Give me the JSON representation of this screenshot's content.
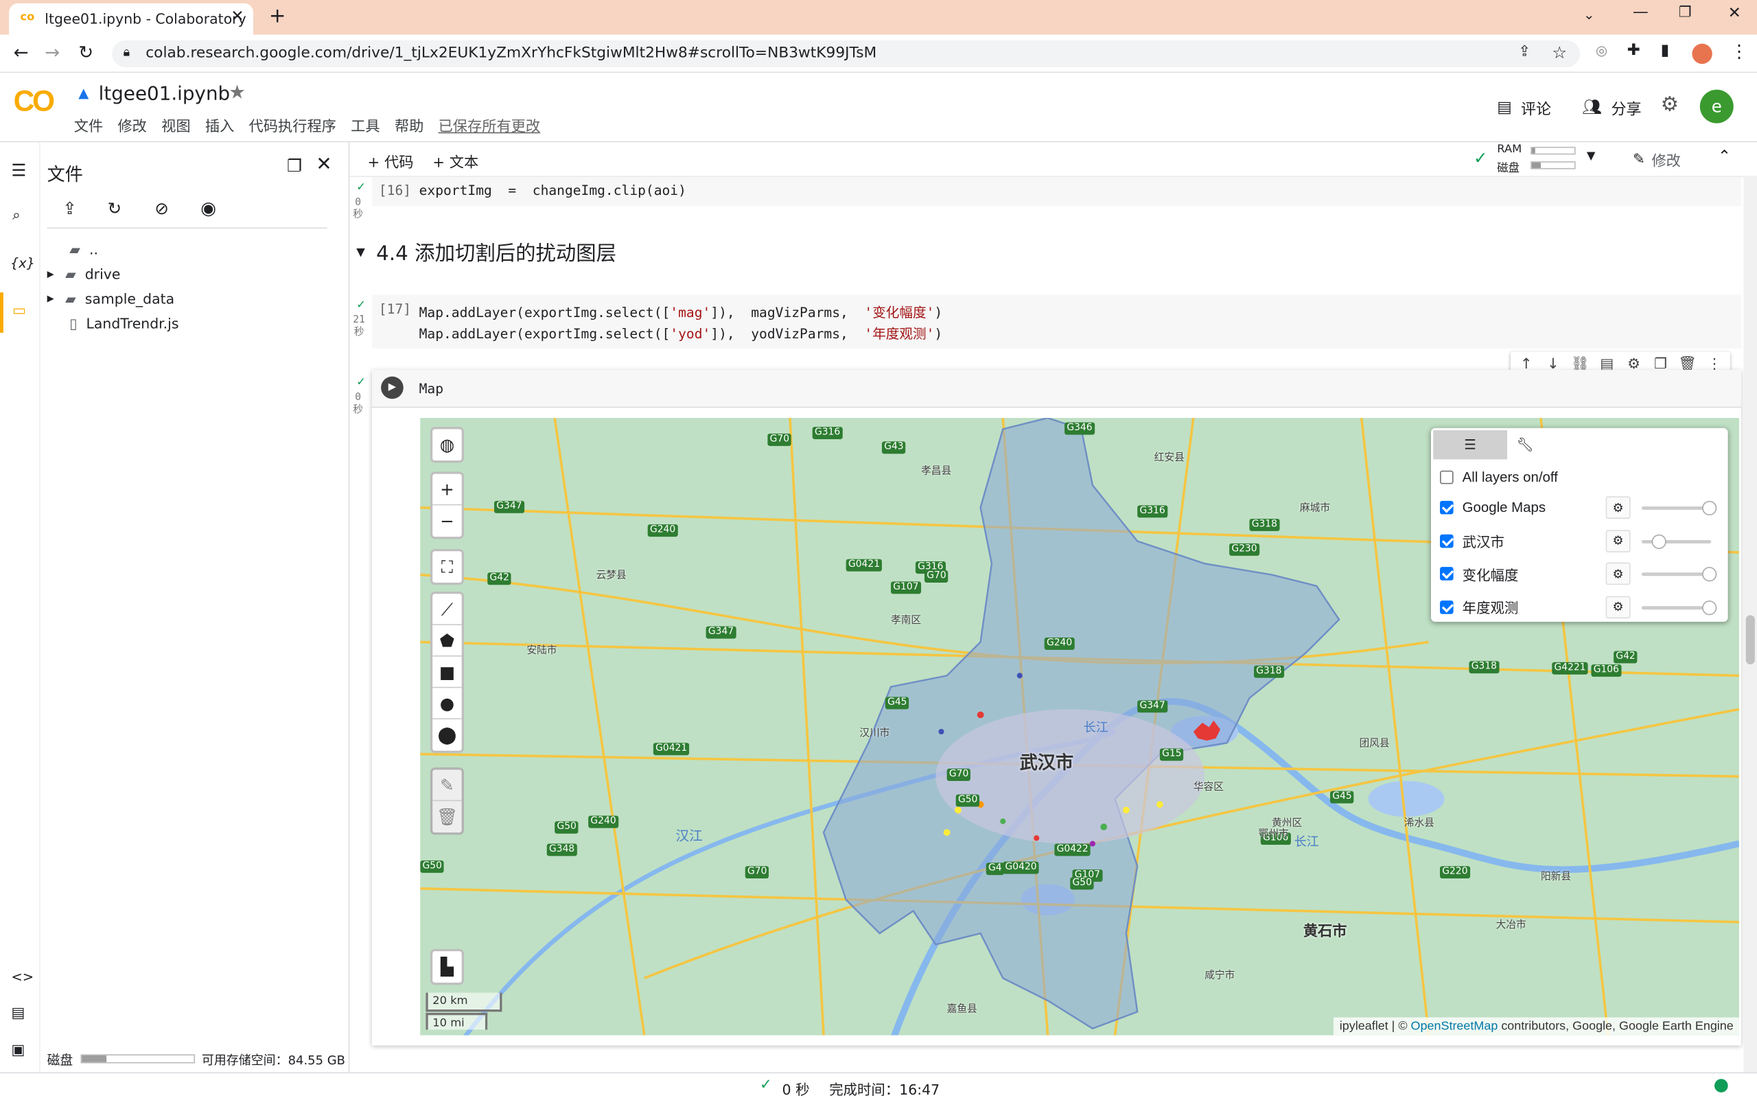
{
  "browser": {
    "tab_title": "ltgee01.ipynb - Colaboratory",
    "url": "colab.research.google.com/drive/1_tjLx2EUK1yZmXrYhcFkStgiwMlt2Hw8#scrollTo=NB3wtK99JTsM"
  },
  "colab": {
    "logo": "CO",
    "notebook_title": "ltgee01.ipynb",
    "menu": [
      "文件",
      "修改",
      "视图",
      "插入",
      "代码执行程序",
      "工具",
      "帮助"
    ],
    "saved_status": "已保存所有更改",
    "comment_label": "评论",
    "share_label": "分享",
    "avatar_letter": "e"
  },
  "sidebar": {
    "title": "文件",
    "tree": [
      {
        "name": "..",
        "type": "up"
      },
      {
        "name": "drive",
        "type": "folder"
      },
      {
        "name": "sample_data",
        "type": "folder"
      },
      {
        "name": "LandTrendr.js",
        "type": "file"
      }
    ],
    "disk_label": "磁盘",
    "disk_free": "可用存储空间：84.55 GB",
    "disk_used_fraction": 0.22
  },
  "toolbar": {
    "add_code": "+ 代码",
    "add_text": "+ 文本",
    "ram_label": "RAM",
    "disk_label": "磁盘",
    "edit_label": "修改"
  },
  "cells": {
    "c16": {
      "prompt": "[16]",
      "code": "exportImg  =  changeImg.clip(aoi)",
      "time": "0\n秒"
    },
    "heading": "4.4 添加切割后的扰动图层",
    "c17": {
      "prompt": "[17]",
      "line1_a": "Map.addLayer(exportImg.select([",
      "line1_s1": "'mag'",
      "line1_b": "]),  magVizParms,  ",
      "line1_s2": "'变化幅度'",
      "line1_c": ")",
      "line2_a": "Map.addLayer(exportImg.select([",
      "line2_s1": "'yod'",
      "line2_b": "]),  yodVizParms,  ",
      "line2_s2": "'年度观测'",
      "line2_c": ")",
      "time": "21\n秒"
    },
    "c18": {
      "code": "Map",
      "time": "0\n秒"
    }
  },
  "map": {
    "city_label": "武汉市",
    "city2_label": "黄石市",
    "river_labels": [
      "长江",
      "汉江",
      "长江"
    ],
    "road_labels": [
      "G70",
      "G316",
      "G346",
      "G43",
      "G347",
      "G240",
      "G42",
      "G0421",
      "G316",
      "G107",
      "G70",
      "G347",
      "G240",
      "G316",
      "G318",
      "G230",
      "G42",
      "G106",
      "G4221",
      "G318",
      "G45",
      "G347",
      "G70",
      "G50",
      "G0420",
      "G4",
      "G0422",
      "G107",
      "G50",
      "G15",
      "G106",
      "G220",
      "G45",
      "G318",
      "G50",
      "G240",
      "G0421",
      "G348",
      "G50",
      "G70"
    ],
    "place_labels": [
      "孝昌县",
      "红安县",
      "麻城市",
      "云梦县",
      "安陆市",
      "孝南区",
      "汉川市",
      "团风县",
      "华容区",
      "鄂州市",
      "黄州区",
      "浠水县",
      "嘉鱼县",
      "咸宁市",
      "阳新县",
      "大冶市"
    ],
    "scale_km": "20 km",
    "scale_mi": "10 mi",
    "attribution_prefix": "ipyleaflet | © ",
    "attribution_link": "OpenStreetMap",
    "attribution_suffix": " contributors, Google, Google Earth Engine",
    "layers_title": "All layers on/off",
    "layers": [
      {
        "name": "Google Maps",
        "checked": true,
        "opacity": 1.0
      },
      {
        "name": "武汉市",
        "checked": true,
        "opacity": 0.2
      },
      {
        "name": "变化幅度",
        "checked": true,
        "opacity": 1.0
      },
      {
        "name": "年度观测",
        "checked": true,
        "opacity": 1.0
      }
    ]
  },
  "status": {
    "elapsed": "0 秒",
    "done": "完成时间：16:47"
  },
  "colors": {
    "colab_orange": "#f9ab00",
    "tab_bar": "#f7d5c2",
    "map_bg": "#bfe0c4",
    "boundary_fill": "#8aa8d8",
    "road": "#f5c542",
    "river": "#7aaee8"
  }
}
